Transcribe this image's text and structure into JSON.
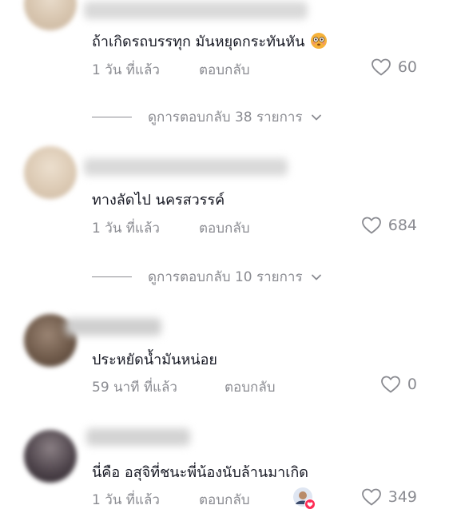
{
  "comments": [
    {
      "text": "ถ้าเกิดรถบรรทุก มันหยุดกระทันหัน",
      "emoji": "flushed-face-icon",
      "time": "1 วัน ที่แล้ว",
      "reply": "ตอบกลับ",
      "likes": "60",
      "view_replies": "ดูการตอบกลับ 38 รายการ"
    },
    {
      "text": "ทางลัดไป นครสวรรค์",
      "time": "1 วัน ที่แล้ว",
      "reply": "ตอบกลับ",
      "likes": "684",
      "view_replies": "ดูการตอบกลับ 10 รายการ"
    },
    {
      "text": "ประหยัดน้ำมันหน่อย",
      "time": "59 นาที ที่แล้ว",
      "reply": "ตอบกลับ",
      "likes": "0"
    },
    {
      "text": "นี่คือ อสุจิที่ชนะพี่น้องนับล้านมาเกิด",
      "time": "1 วัน ที่แล้ว",
      "reply": "ตอบกลับ",
      "likes": "349",
      "liked_by_creator": "creator-liked-avatar-icon"
    }
  ],
  "colors": {
    "text": "#161823",
    "meta": "#8a8b91",
    "heart_badge": "#fe2c55"
  }
}
